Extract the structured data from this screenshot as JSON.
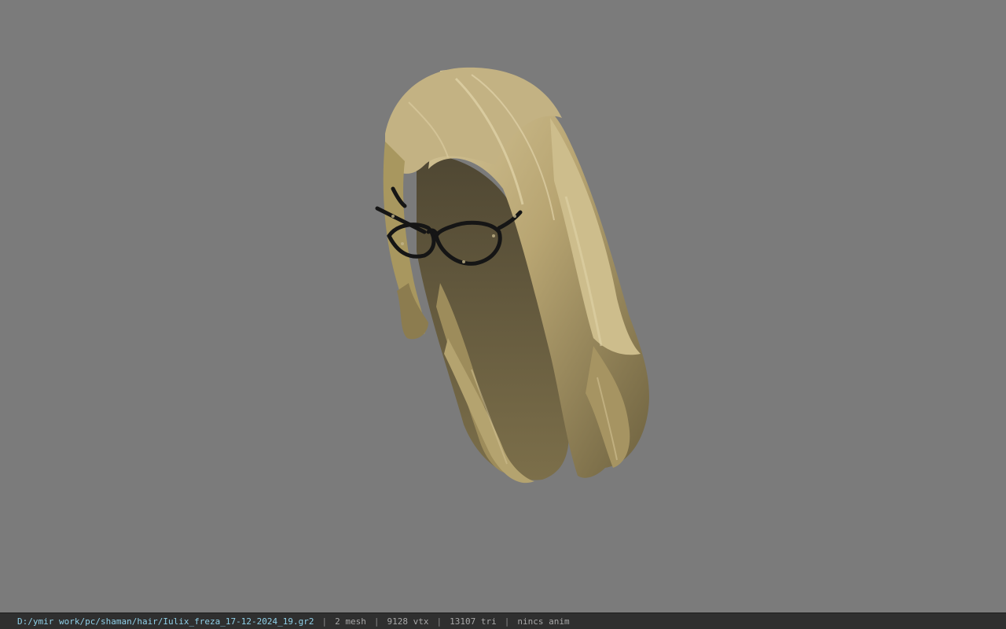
{
  "viewport": {
    "background_color": "#7b7b7b",
    "model": {
      "name": "hair-with-glasses-model",
      "hair_color": "#b8a572",
      "glasses_color": "#151515"
    }
  },
  "statusbar": {
    "path": "D:/ymir work/pc/shaman/hair/Iulix_freza_17-12-2024_19.gr2",
    "separator": "|",
    "mesh": "2 mesh",
    "vertices": "9128 vtx",
    "triangles": "13107 tri",
    "animation": "nincs anim"
  }
}
